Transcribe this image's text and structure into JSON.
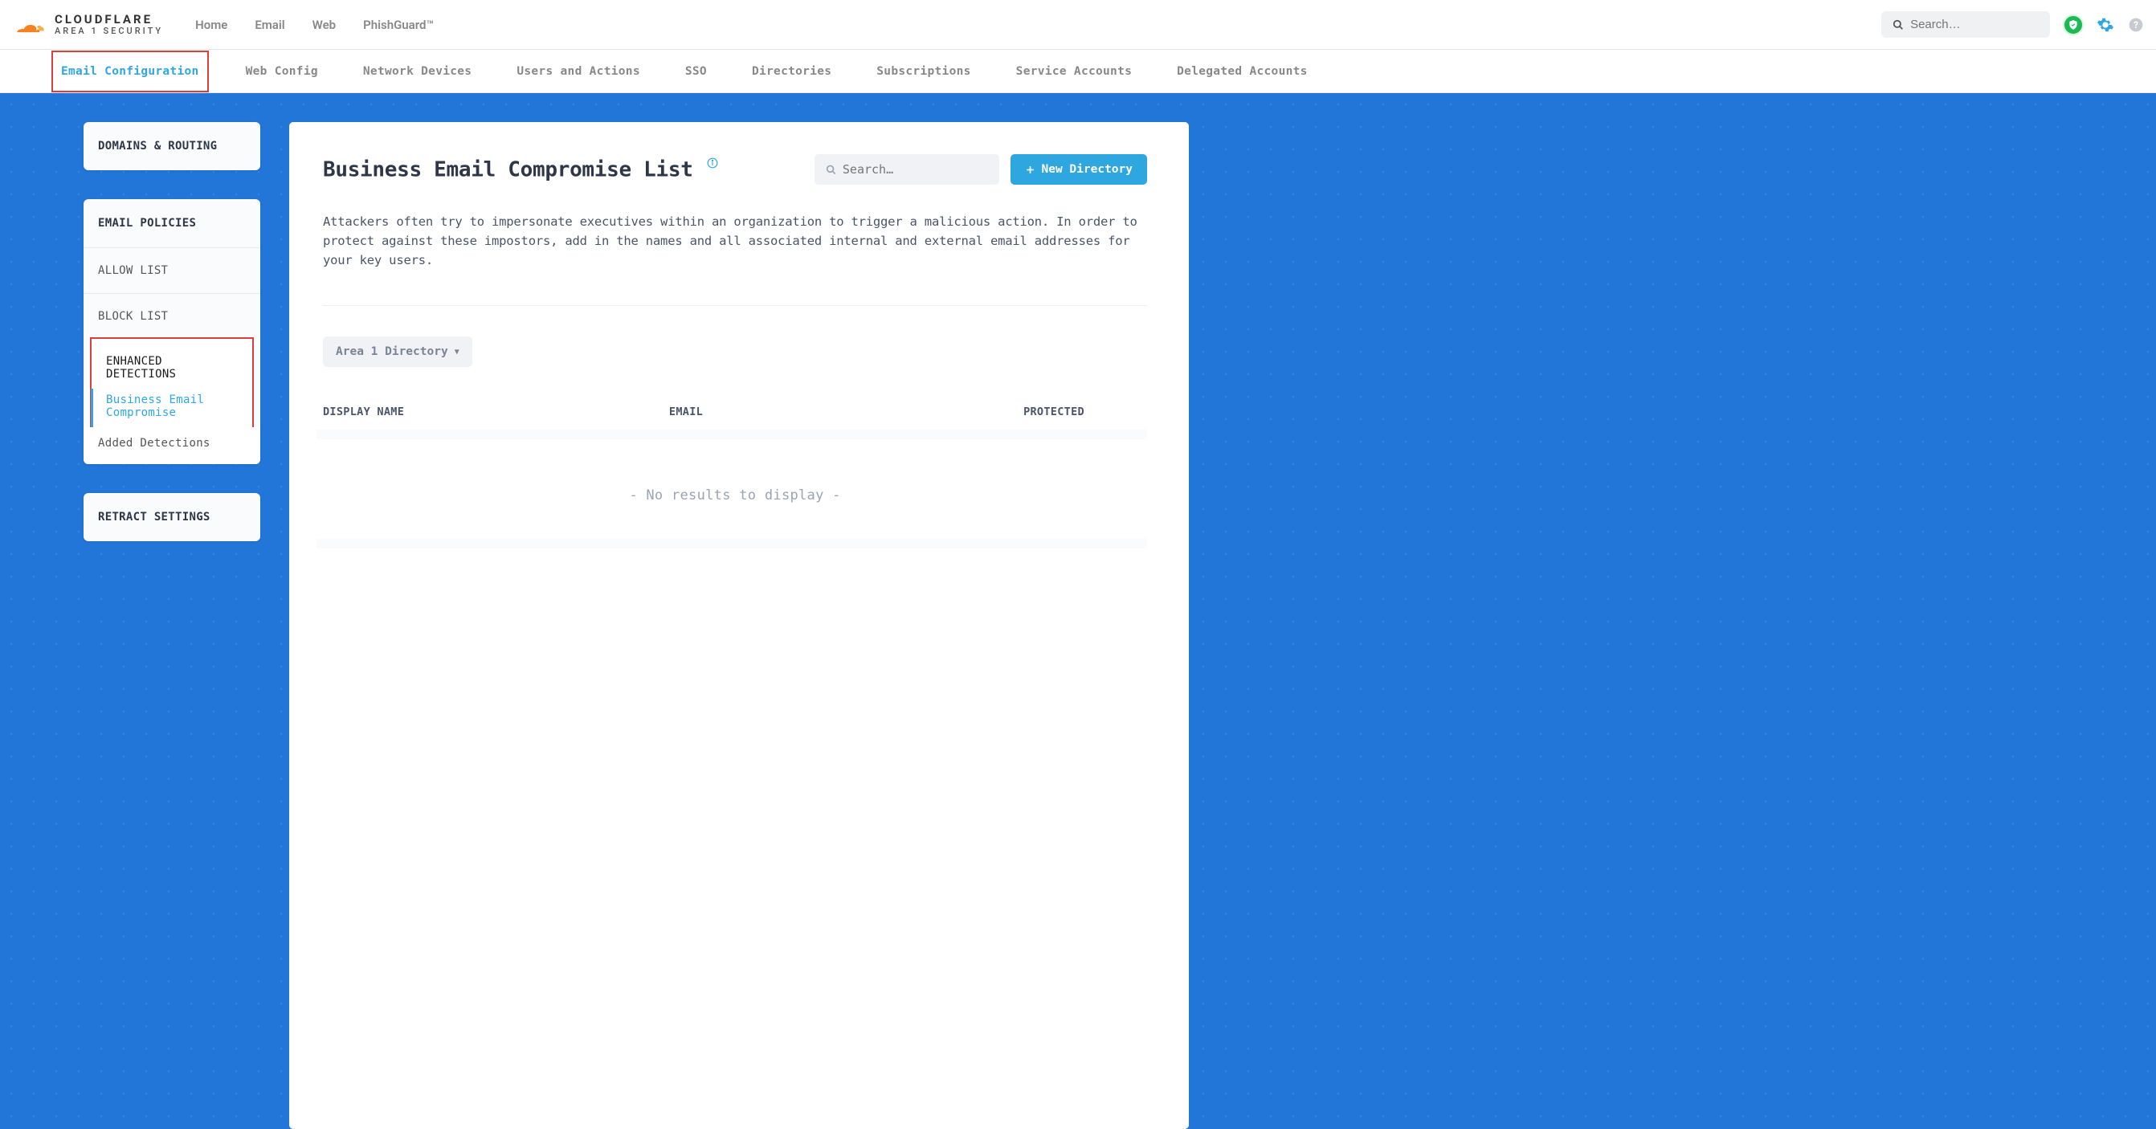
{
  "logo": {
    "main": "CLOUDFLARE",
    "sub": "AREA 1 SECURITY"
  },
  "topnav": {
    "home": "Home",
    "email": "Email",
    "web": "Web",
    "phishguard": "PhishGuard™"
  },
  "search_top": {
    "placeholder": "Search…"
  },
  "subnav": {
    "email_config": "Email Configuration",
    "web_config": "Web Config",
    "network_devices": "Network Devices",
    "users_actions": "Users and Actions",
    "sso": "SSO",
    "directories": "Directories",
    "subscriptions": "Subscriptions",
    "service_accounts": "Service Accounts",
    "delegated_accounts": "Delegated Accounts"
  },
  "sidebar": {
    "domains_routing": "DOMAINS & ROUTING",
    "email_policies": "EMAIL POLICIES",
    "allow_list": "ALLOW LIST",
    "block_list": "BLOCK LIST",
    "enhanced_detections": "ENHANCED DETECTIONS",
    "bec": "Business Email Compromise",
    "added_detections": "Added Detections",
    "retract_settings": "RETRACT SETTINGS"
  },
  "main": {
    "title": "Business Email Compromise List",
    "search_placeholder": "Search…",
    "new_directory": "New Directory",
    "description": "Attackers often try to impersonate executives within an organization to trigger a malicious action. In order to protect against these impostors, add in the names and all associated internal and external email addresses for your key users.",
    "filter_label": "Area 1 Directory",
    "columns": {
      "display_name": "DISPLAY NAME",
      "email": "EMAIL",
      "protected": "PROTECTED"
    },
    "empty": "- No results to display -"
  }
}
